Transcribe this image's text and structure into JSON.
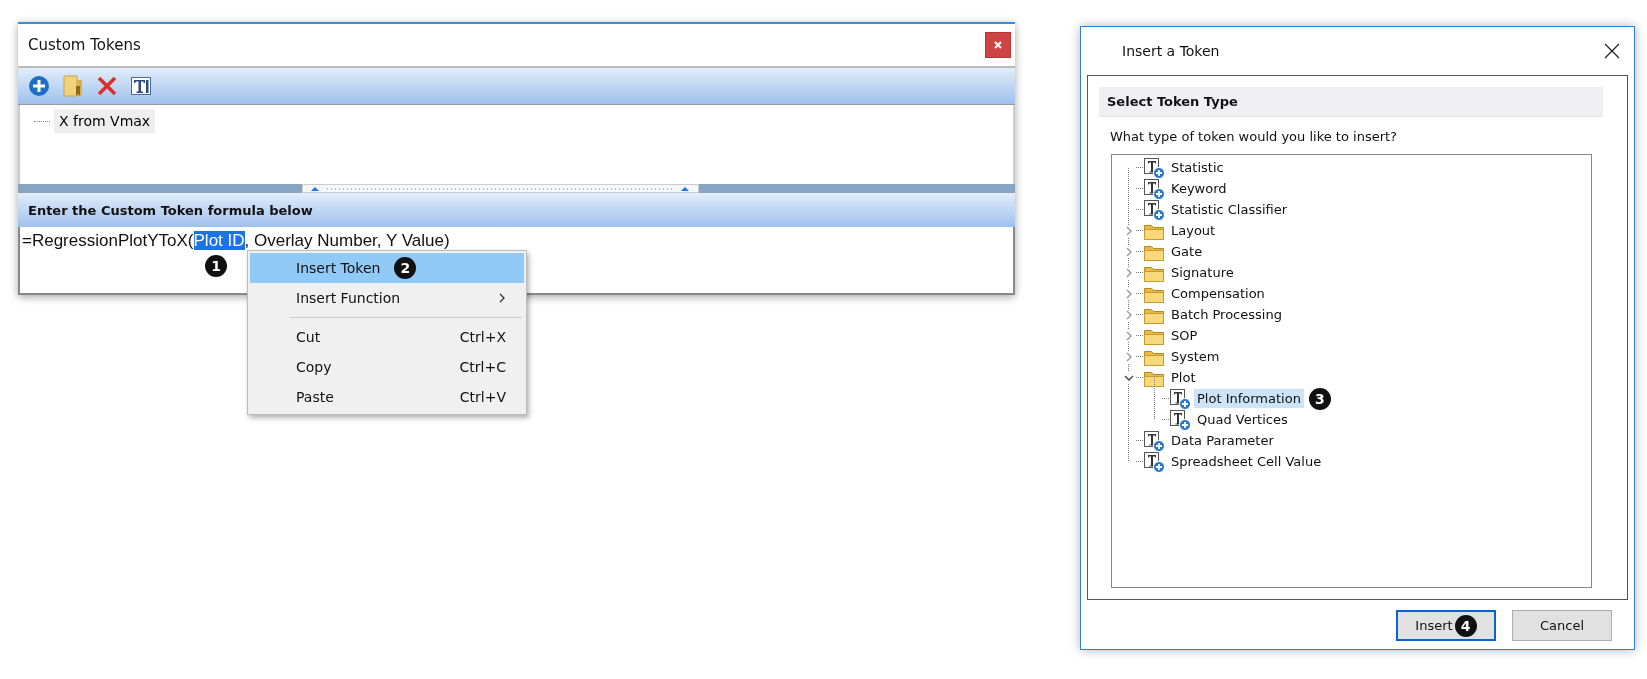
{
  "custom_tokens_window": {
    "title": "Custom Tokens",
    "token_list": [
      {
        "label": "X from Vmax",
        "selected": true
      }
    ],
    "formula_section": {
      "header": "Enter the Custom Token formula below",
      "formula_before": "=RegressionPlotYToX(",
      "formula_selection": "Plot ID",
      "formula_after": ", Overlay Number, Y Value)",
      "callout": "1"
    }
  },
  "context_menu": {
    "items": [
      {
        "kind": "item",
        "label": "Insert Token",
        "selected": true,
        "submenu": false,
        "callout": "2"
      },
      {
        "kind": "item",
        "label": "Insert Function",
        "selected": false,
        "submenu": true
      },
      {
        "kind": "separator"
      },
      {
        "kind": "item",
        "label": "Cut",
        "shortcut": "Ctrl+X",
        "selected": false,
        "submenu": false
      },
      {
        "kind": "item",
        "label": "Copy",
        "shortcut": "Ctrl+C",
        "selected": false,
        "submenu": false
      },
      {
        "kind": "item",
        "label": "Paste",
        "shortcut": "Ctrl+V",
        "selected": false,
        "submenu": false
      }
    ]
  },
  "insert_token_dialog": {
    "title": "Insert a Token",
    "section_title": "Select Token Type",
    "prompt": "What type of token would you like to insert?",
    "tree": [
      {
        "kind": "token",
        "label": "Statistic",
        "selected": false
      },
      {
        "kind": "token",
        "label": "Keyword",
        "selected": false
      },
      {
        "kind": "token",
        "label": "Statistic Classifier",
        "selected": false
      },
      {
        "kind": "folder",
        "label": "Layout",
        "expanded": false,
        "selected": false
      },
      {
        "kind": "folder",
        "label": "Gate",
        "expanded": false,
        "selected": false
      },
      {
        "kind": "folder",
        "label": "Signature",
        "expanded": false,
        "selected": false
      },
      {
        "kind": "folder",
        "label": "Compensation",
        "expanded": false,
        "selected": false
      },
      {
        "kind": "folder",
        "label": "Batch Processing",
        "expanded": false,
        "selected": false
      },
      {
        "kind": "folder",
        "label": "SOP",
        "expanded": false,
        "selected": false
      },
      {
        "kind": "folder",
        "label": "System",
        "expanded": false,
        "selected": false
      },
      {
        "kind": "folder",
        "label": "Plot",
        "expanded": true,
        "selected": false,
        "children": [
          {
            "kind": "token",
            "label": "Plot Information",
            "selected": true,
            "callout": "3"
          },
          {
            "kind": "token",
            "label": "Quad Vertices",
            "selected": false
          }
        ]
      },
      {
        "kind": "token",
        "label": "Data Parameter",
        "selected": false
      },
      {
        "kind": "token",
        "label": "Spreadsheet Cell Value",
        "selected": false
      }
    ],
    "buttons": [
      {
        "label": "Insert",
        "default": true,
        "callout": "4"
      },
      {
        "label": "Cancel",
        "default": false
      }
    ]
  }
}
